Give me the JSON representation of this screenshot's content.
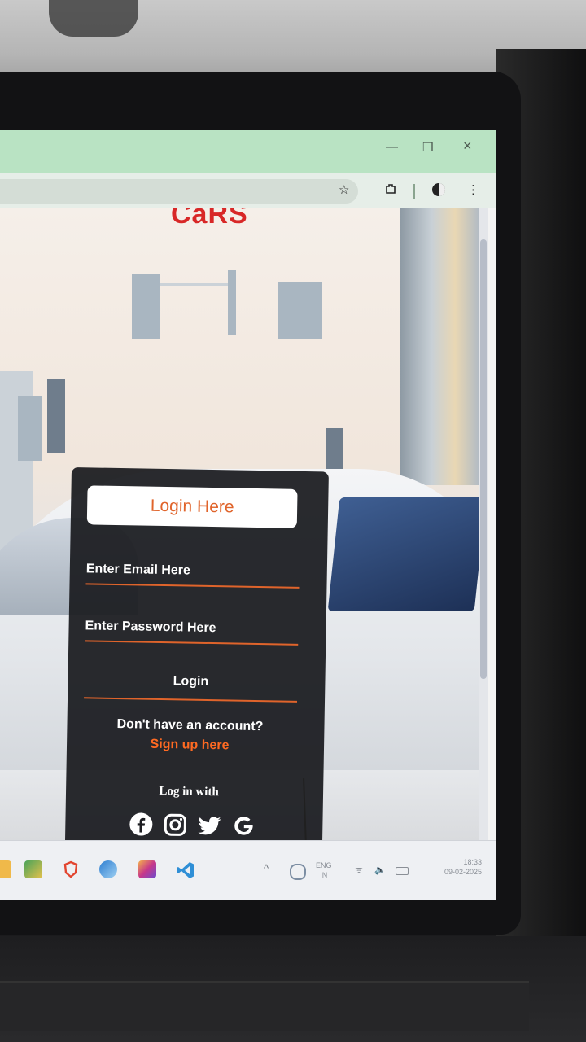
{
  "browser": {
    "window_controls": {
      "restore_icon": "restore-icon",
      "close_label": "×"
    },
    "toolbar_icons": [
      "star-icon",
      "extensions-icon",
      "profile-icon",
      "menu-icon"
    ]
  },
  "page": {
    "site_title": "CaRS",
    "login_card": {
      "heading": "Login Here",
      "email_placeholder": "Enter Email Here",
      "password_placeholder": "Enter Password Here",
      "login_label": "Login",
      "no_account_text": "Don't have an account?",
      "signup_link": "Sign up here",
      "login_with_text": "Log in with",
      "social_icons": [
        "facebook-icon",
        "instagram-icon",
        "twitter-icon",
        "google-icon"
      ]
    }
  },
  "taskbar": {
    "apps": [
      "file-explorer-icon",
      "photos-icon",
      "brave-icon",
      "app-icon",
      "instagram-icon",
      "vscode-icon"
    ],
    "tray": {
      "lang_top": "ENG",
      "lang_bottom": "IN",
      "time": "18:33",
      "date": "09-02-2025"
    }
  },
  "colors": {
    "accent": "#e0642b",
    "title_red": "#d82727",
    "card_bg": "#1c1d21",
    "browser_tab_green": "#b9e3c3"
  }
}
